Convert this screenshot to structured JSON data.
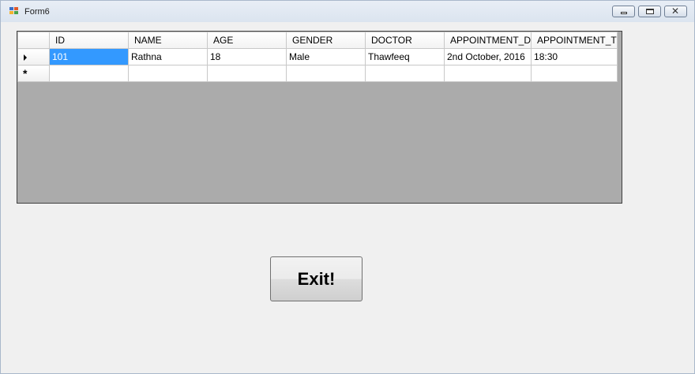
{
  "window": {
    "title": "Form6",
    "icons": {
      "app": "form-app-icon",
      "minimize": "minimize-icon",
      "restore": "restore-icon",
      "close": "close-icon"
    }
  },
  "grid": {
    "columns": [
      "ID",
      "NAME",
      "AGE",
      "GENDER",
      "DOCTOR",
      "APPOINTMENT_D",
      "APPOINTMENT_T"
    ],
    "rows": [
      [
        "101",
        "Rathna",
        "18",
        "Male",
        "Thawfeeq",
        "2nd October, 2016",
        "18:30"
      ]
    ],
    "current_row_indicator": "current-row-arrow-icon",
    "new_row_indicator": "new-row-asterisk-icon",
    "new_row_symbol": "*",
    "selected_color": "#3399ff",
    "background_color": "#ababab"
  },
  "exit_button": {
    "label": "Exit!"
  }
}
